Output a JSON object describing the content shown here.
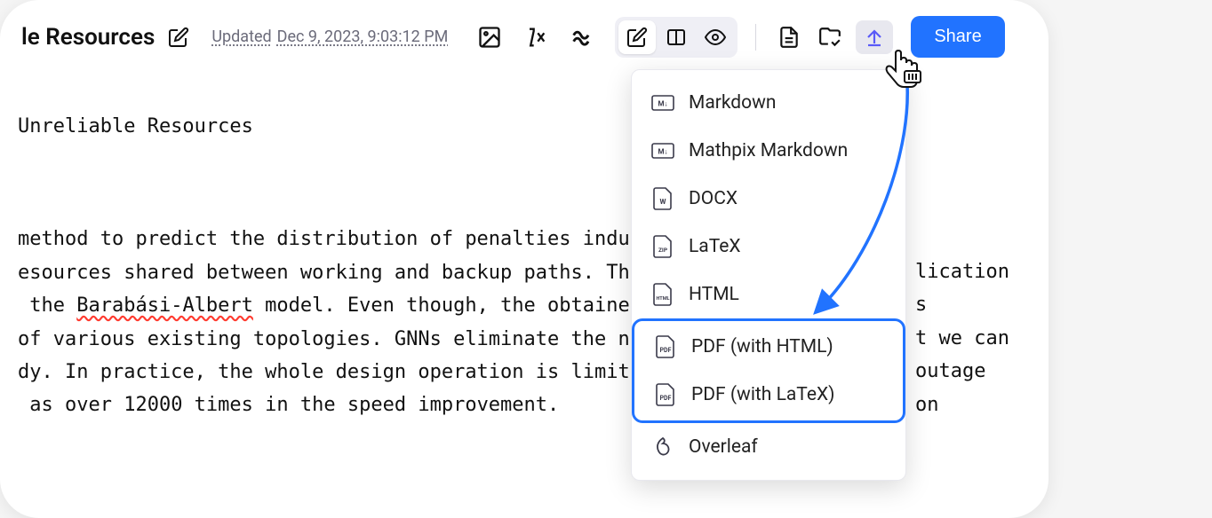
{
  "header": {
    "title_suffix": "le Resources",
    "updated_label": "Updated",
    "updated_time": "Dec 9, 2023, 9:03:12 PM"
  },
  "share_label": "Share",
  "document": {
    "heading": "Unreliable Resources",
    "body_pre": "method to predict the distribution of penalties indu\nesources shared between working and backup paths. Th\n the ",
    "squiggle": "Barabási-Albert",
    "body_post": " model. Even though, the obtaine\nof various existing topologies. GNNs eliminate the n\ndy. In practice, the whole design operation is limit\n as over 12000 times in the speed improvement.",
    "right_fragments": [
      "lication",
      "s",
      "t we can",
      " outage",
      " on"
    ]
  },
  "export_menu": {
    "items": [
      {
        "label": "Markdown",
        "icon": "md"
      },
      {
        "label": "Mathpix Markdown",
        "icon": "md"
      },
      {
        "label": "DOCX",
        "icon": "docx"
      },
      {
        "label": "LaTeX",
        "icon": "zip"
      },
      {
        "label": "HTML",
        "icon": "html"
      },
      {
        "label": "PDF (with HTML)",
        "icon": "pdf"
      },
      {
        "label": "PDF (with LaTeX)",
        "icon": "pdf"
      },
      {
        "label": "Overleaf",
        "icon": "overleaf"
      }
    ]
  }
}
